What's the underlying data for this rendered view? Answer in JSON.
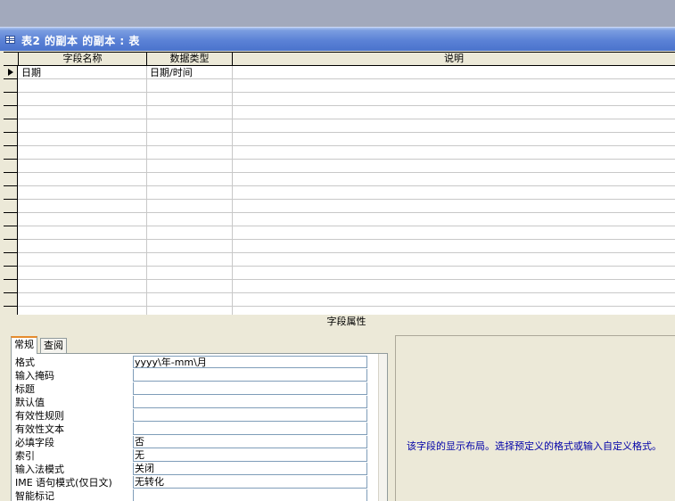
{
  "window": {
    "title": "表2 的副本 的副本 : 表"
  },
  "grid": {
    "columns": [
      "字段名称",
      "数据类型",
      "说明"
    ],
    "rows": [
      {
        "field_name": "日期",
        "data_type": "日期/时间",
        "description": ""
      }
    ]
  },
  "field_properties": {
    "header": "字段属性",
    "tabs": [
      "常规",
      "查阅"
    ],
    "active_tab": "常规",
    "rows": [
      {
        "label": "格式",
        "value": "yyyy\\年-mm\\月"
      },
      {
        "label": "输入掩码",
        "value": ""
      },
      {
        "label": "标题",
        "value": ""
      },
      {
        "label": "默认值",
        "value": ""
      },
      {
        "label": "有效性规则",
        "value": ""
      },
      {
        "label": "有效性文本",
        "value": ""
      },
      {
        "label": "必填字段",
        "value": "否"
      },
      {
        "label": "索引",
        "value": "无"
      },
      {
        "label": "输入法模式",
        "value": "关闭"
      },
      {
        "label": "IME 语句模式(仅日文)",
        "value": "无转化"
      },
      {
        "label": "智能标记",
        "value": ""
      }
    ],
    "help_text": "该字段的显示布局。选择预定义的格式或输入自定义格式。"
  },
  "colors": {
    "title_bar": "#4a73cc",
    "help_text": "#0000a8",
    "face": "#ece9d8"
  },
  "icons": {
    "title": "table-icon",
    "current_row": "row-pointer-icon"
  }
}
